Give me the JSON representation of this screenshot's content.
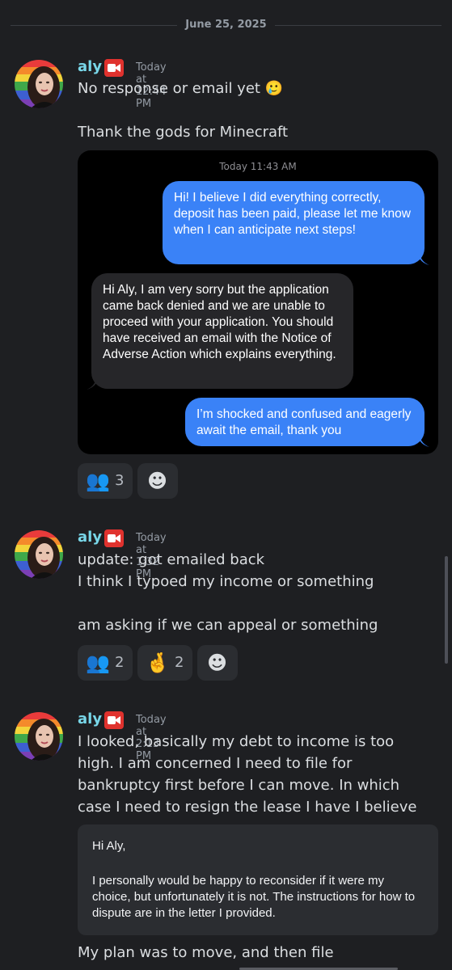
{
  "date_divider": "June 25, 2025",
  "messages": [
    {
      "author": "aly",
      "timestamp": "Today at 12:44 PM",
      "lines": [
        "No response or email yet 🥲",
        "Thank the gods for Minecraft"
      ],
      "attachment": {
        "time_label": "Today 11:43 AM",
        "bubbles": [
          {
            "direction": "outgoing",
            "text": "Hi! I believe I did everything correctly, deposit has been paid, please let me know when I can anticipate next steps!"
          },
          {
            "direction": "incoming",
            "text": "Hi Aly, I am very sorry but the application came back denied and we are unable to proceed with your application. You should have received an email with the Notice of Adverse Action which explains everything."
          },
          {
            "direction": "outgoing",
            "text": "I’m shocked and confused and eagerly await the email, thank you"
          }
        ]
      },
      "reactions": [
        {
          "icon": "busts-in-silhouette-icon",
          "emoji": "👥",
          "count": "3"
        },
        {
          "icon": "add-reaction-icon",
          "emoji": "☻",
          "count": ""
        }
      ]
    },
    {
      "author": "aly",
      "timestamp": "Today at 1:32 PM",
      "lines": [
        "update: got emailed back",
        "I think I typoed my income or something",
        "am asking if we can appeal or something"
      ],
      "reactions": [
        {
          "icon": "busts-in-silhouette-icon",
          "emoji": "👥",
          "count": "2"
        },
        {
          "icon": "crossed-fingers-icon",
          "emoji": "🤞",
          "count": "2"
        },
        {
          "icon": "add-reaction-icon",
          "emoji": "☻",
          "count": ""
        }
      ]
    },
    {
      "author": "aly",
      "timestamp": "Today at 2:13 PM",
      "paragraph": "I looked, basically my debt to income is too high. I am concerned I need to file for bankruptcy first before I can move. In which case I need to resign the lease I have I believe",
      "quote": {
        "greeting": "Hi Aly,",
        "body": "I personally would be happy to reconsider if it were my choice, but unfortunately it is not. The instructions for how to dispute are in the letter I provided."
      },
      "trailing_line": "My plan was to move, and then file"
    }
  ],
  "colors": {
    "background": "#1e1f22",
    "username": "#78d6e8",
    "timestamp": "#949ba4",
    "message_text": "#dbdee1",
    "imessage_blue": "#3a82f7",
    "imessage_gray": "#262629",
    "reaction_bg": "#2b2d31",
    "camera_badge": "#e0322e"
  }
}
